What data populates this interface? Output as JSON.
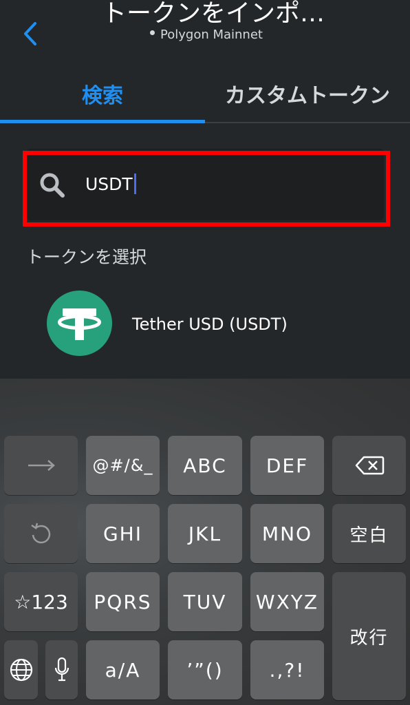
{
  "header": {
    "title": "トークンをインポ…",
    "network": "Polygon Mainnet"
  },
  "tabs": {
    "search": "検索",
    "custom": "カスタムトークン"
  },
  "search": {
    "value": "USDT"
  },
  "results": {
    "label": "トークンを選択",
    "tokens": [
      {
        "name": "Tether USD (USDT)",
        "icon": "tether-icon",
        "color": "#26a17b"
      }
    ]
  },
  "keyboard": {
    "row1": [
      "→",
      "@#/&_",
      "ABC",
      "DEF",
      "backspace-icon"
    ],
    "row2": [
      "undo-icon",
      "GHI",
      "JKL",
      "MNO",
      "空白"
    ],
    "row3": [
      "☆123",
      "PQRS",
      "TUV",
      "WXYZ",
      "改行"
    ],
    "row4": [
      "globe-icon",
      "mic-icon",
      "a/A",
      "’”()",
      ".,?!"
    ]
  },
  "colors": {
    "accent": "#1f8ff2",
    "highlight": "#ff0000",
    "background": "#24272a"
  }
}
